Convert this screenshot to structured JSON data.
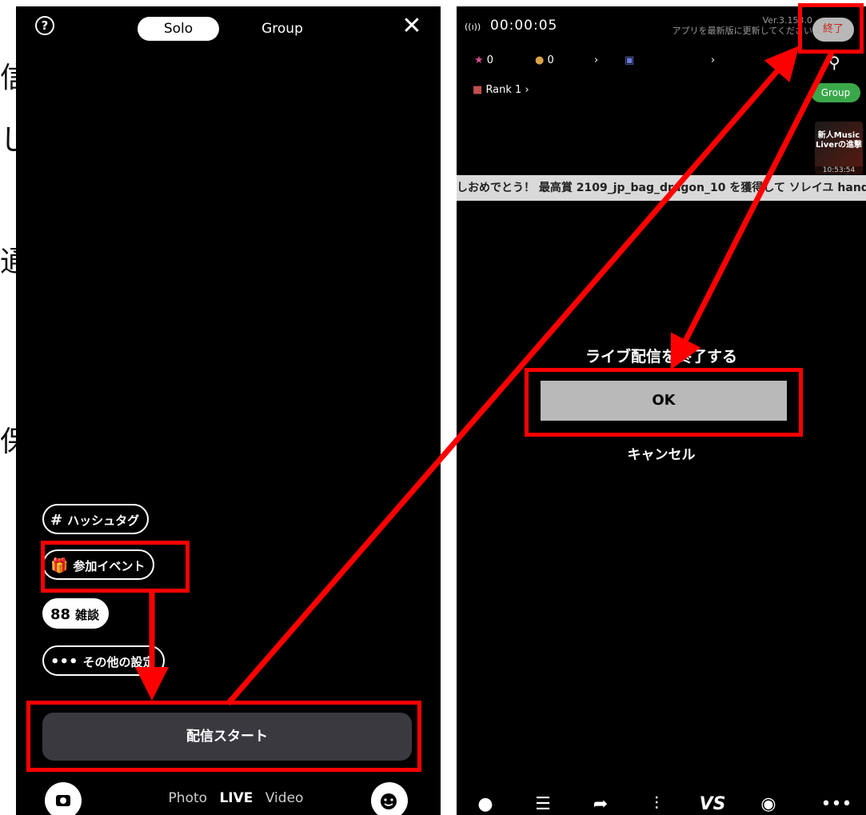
{
  "cutoff_glyphs": [
    "信",
    "し",
    "通",
    "保"
  ],
  "left": {
    "tabs": {
      "solo": "Solo",
      "group": "Group"
    },
    "help_icon": "?",
    "close_icon": "✕",
    "options": [
      {
        "icon": "#",
        "label": "ハッシュタグ"
      },
      {
        "icon": "🎁",
        "label": "参加イベント"
      },
      {
        "icon": "88",
        "label": "雑談"
      },
      {
        "icon": "•••",
        "label": "その他の設定"
      }
    ],
    "start_button": "配信スタート",
    "modes": {
      "photo": "Photo",
      "live": "LIVE",
      "video": "Video"
    }
  },
  "right": {
    "signal_icon": "((ı))",
    "timer": "00:00:05",
    "version": "Ver.3.153.0",
    "update_notice": "アプリを最新版に更新してください",
    "end_button": "終了",
    "stats": {
      "stars": "0",
      "coins": "0"
    },
    "rank": "Rank 1",
    "group_pill": "Group",
    "banner_text": "新人Music Liverの進撃",
    "banner_time": "10:53:54",
    "marquee": "しおめでとう！ 最高賞 2109_jp_bag_dragon_10 を獲得して ソレイユ handm",
    "dialog": {
      "title": "ライブ配信を終了する",
      "ok": "OK",
      "cancel": "キャンセル"
    },
    "nav_items": [
      "chat-icon",
      "viewers-icon",
      "share-icon",
      "ranking-icon",
      "vs-icon",
      "record-icon",
      "more-icon"
    ],
    "nav_vs_label": "VS"
  },
  "colors": {
    "annotation": "#ff0000",
    "group_green": "#3aa84a",
    "end_text": "#c8261a"
  }
}
